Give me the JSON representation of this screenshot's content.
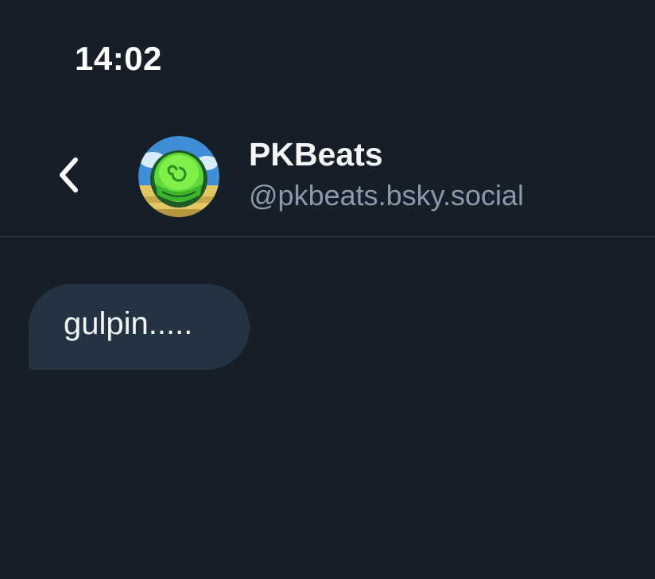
{
  "status_bar": {
    "time": "14:02"
  },
  "header": {
    "back_icon": "chevron-left-icon",
    "avatar_icon": "gulpin-avatar",
    "display_name": "PKBeats",
    "handle": "@pkbeats.bsky.social"
  },
  "messages": [
    {
      "text": "gulpin....."
    }
  ],
  "colors": {
    "background": "#161e27",
    "bubble": "#243342",
    "handle_text": "#8a9aab",
    "divider": "#2e3a46"
  }
}
